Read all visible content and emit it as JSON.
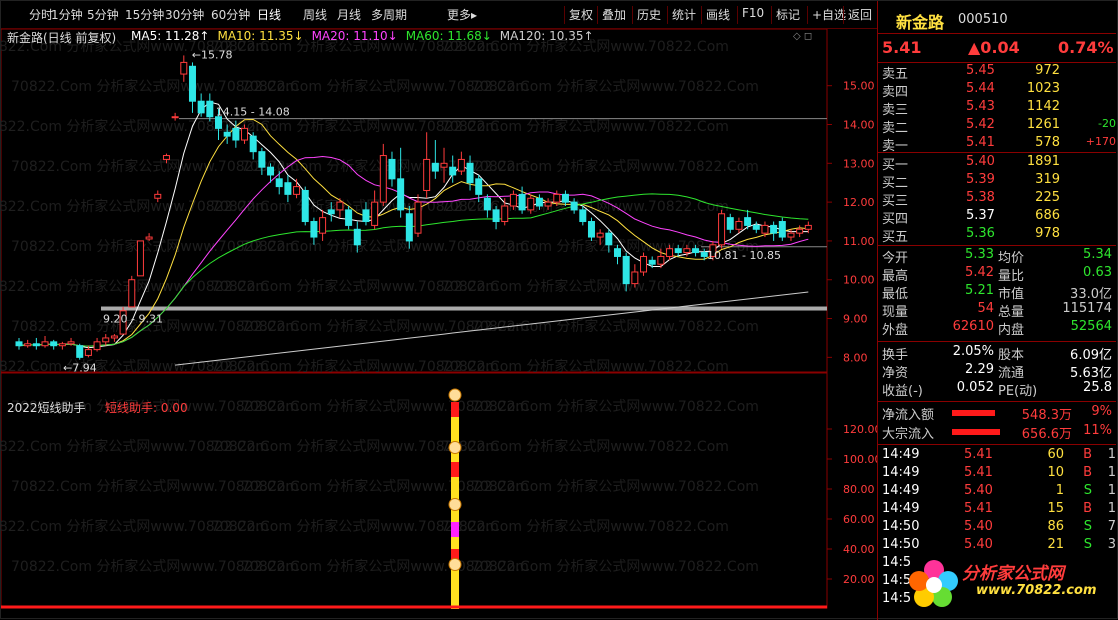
{
  "toolbar": {
    "left": [
      "分时",
      "1分钟",
      "5分钟",
      "15分钟",
      "30分钟",
      "60分钟",
      "日线",
      "周线",
      "月线",
      "多周期",
      "更多▸"
    ],
    "active": "日线",
    "right": [
      "复权",
      "叠加",
      "历史",
      "统计",
      "画线",
      "F10",
      "标记",
      "+自选",
      "返回"
    ]
  },
  "chart_header": {
    "title": "新金路(日线 前复权)",
    "ma": [
      {
        "label": "MA5: 11.28↑",
        "color": "#ffffff"
      },
      {
        "label": "MA10: 11.35↓",
        "color": "#ffe040"
      },
      {
        "label": "MA20: 11.10↓",
        "color": "#ff44ff"
      },
      {
        "label": "MA60: 11.68↓",
        "color": "#2ee62e"
      },
      {
        "label": "MA120: 10.35↑",
        "color": "#cccccc"
      }
    ]
  },
  "chart_data": [
    {
      "type": "line",
      "name": "main-kline",
      "y_ticks": [
        "15.00",
        "14.00",
        "13.00",
        "12.00",
        "11.00",
        "10.00",
        "9.00",
        "8.00"
      ],
      "ylim": [
        7.7,
        16.1
      ],
      "annotations": [
        "15.78",
        "14.15 - 14.08",
        "9.20 - 9.31",
        "10.81 - 10.85",
        "7.94"
      ],
      "candles": [
        {
          "o": 8.4,
          "c": 8.3,
          "h": 8.5,
          "l": 8.2
        },
        {
          "o": 8.3,
          "c": 8.35,
          "h": 8.45,
          "l": 8.25
        },
        {
          "o": 8.35,
          "c": 8.3,
          "h": 8.5,
          "l": 8.2
        },
        {
          "o": 8.3,
          "c": 8.4,
          "h": 8.55,
          "l": 8.25
        },
        {
          "o": 8.4,
          "c": 8.3,
          "h": 8.45,
          "l": 8.2
        },
        {
          "o": 8.3,
          "c": 8.35,
          "h": 8.4,
          "l": 8.2
        },
        {
          "o": 8.35,
          "c": 8.4,
          "h": 8.5,
          "l": 8.3
        },
        {
          "o": 8.3,
          "c": 8.0,
          "h": 8.35,
          "l": 7.94
        },
        {
          "o": 8.05,
          "c": 8.2,
          "h": 8.3,
          "l": 8.0
        },
        {
          "o": 8.2,
          "c": 8.4,
          "h": 8.5,
          "l": 8.15
        },
        {
          "o": 8.4,
          "c": 8.5,
          "h": 8.6,
          "l": 8.3
        },
        {
          "o": 8.5,
          "c": 8.55,
          "h": 8.6,
          "l": 8.4
        },
        {
          "o": 8.6,
          "c": 9.2,
          "h": 9.3,
          "l": 8.6
        },
        {
          "o": 9.3,
          "c": 10.0,
          "h": 10.1,
          "l": 9.3
        },
        {
          "o": 10.1,
          "c": 11.0,
          "h": 11.0,
          "l": 10.1
        },
        {
          "o": 11.05,
          "c": 11.1,
          "h": 11.2,
          "l": 11.0
        },
        {
          "o": 12.1,
          "c": 12.2,
          "h": 12.3,
          "l": 12.0
        },
        {
          "o": 13.1,
          "c": 13.2,
          "h": 13.25,
          "l": 13.0
        },
        {
          "o": 14.2,
          "c": 14.2,
          "h": 14.3,
          "l": 14.1
        },
        {
          "o": 15.3,
          "c": 15.6,
          "h": 15.78,
          "l": 15.1
        },
        {
          "o": 15.5,
          "c": 14.6,
          "h": 15.6,
          "l": 14.3
        },
        {
          "o": 14.6,
          "c": 14.3,
          "h": 14.8,
          "l": 14.2
        },
        {
          "o": 14.6,
          "c": 14.2,
          "h": 14.8,
          "l": 14.08
        },
        {
          "o": 14.2,
          "c": 13.9,
          "h": 14.4,
          "l": 13.6
        },
        {
          "o": 13.8,
          "c": 13.7,
          "h": 14.0,
          "l": 13.5
        },
        {
          "o": 13.9,
          "c": 13.6,
          "h": 14.1,
          "l": 13.4
        },
        {
          "o": 13.6,
          "c": 13.9,
          "h": 14.0,
          "l": 13.5
        },
        {
          "o": 13.7,
          "c": 13.3,
          "h": 13.8,
          "l": 13.1
        },
        {
          "o": 13.3,
          "c": 12.9,
          "h": 13.4,
          "l": 12.7
        },
        {
          "o": 12.9,
          "c": 12.7,
          "h": 13.0,
          "l": 12.5
        },
        {
          "o": 12.6,
          "c": 12.4,
          "h": 12.8,
          "l": 12.2
        },
        {
          "o": 12.5,
          "c": 12.2,
          "h": 12.7,
          "l": 12.0
        },
        {
          "o": 12.2,
          "c": 12.4,
          "h": 12.6,
          "l": 12.1
        },
        {
          "o": 12.3,
          "c": 11.5,
          "h": 12.4,
          "l": 11.4
        },
        {
          "o": 11.5,
          "c": 11.1,
          "h": 11.6,
          "l": 10.9
        },
        {
          "o": 11.2,
          "c": 11.6,
          "h": 11.8,
          "l": 11.0
        },
        {
          "o": 11.8,
          "c": 11.7,
          "h": 12.0,
          "l": 11.5
        },
        {
          "o": 11.8,
          "c": 12.0,
          "h": 12.1,
          "l": 11.6
        },
        {
          "o": 11.8,
          "c": 11.4,
          "h": 11.9,
          "l": 11.3
        },
        {
          "o": 11.3,
          "c": 10.9,
          "h": 11.5,
          "l": 10.7
        },
        {
          "o": 11.8,
          "c": 11.5,
          "h": 12.0,
          "l": 11.4
        },
        {
          "o": 11.4,
          "c": 12.0,
          "h": 12.3,
          "l": 11.3
        },
        {
          "o": 12.0,
          "c": 13.2,
          "h": 13.5,
          "l": 11.9
        },
        {
          "o": 13.1,
          "c": 12.6,
          "h": 13.3,
          "l": 12.4
        },
        {
          "o": 12.6,
          "c": 11.8,
          "h": 13.4,
          "l": 11.6
        },
        {
          "o": 11.7,
          "c": 11.0,
          "h": 11.9,
          "l": 10.8
        },
        {
          "o": 11.2,
          "c": 12.0,
          "h": 12.2,
          "l": 11.1
        },
        {
          "o": 12.3,
          "c": 13.1,
          "h": 13.8,
          "l": 12.1
        },
        {
          "o": 13.0,
          "c": 12.8,
          "h": 13.6,
          "l": 12.6
        },
        {
          "o": 12.9,
          "c": 13.0,
          "h": 13.4,
          "l": 12.5
        },
        {
          "o": 12.9,
          "c": 12.7,
          "h": 13.2,
          "l": 12.5
        },
        {
          "o": 12.8,
          "c": 13.1,
          "h": 13.3,
          "l": 12.7
        },
        {
          "o": 13.0,
          "c": 12.5,
          "h": 13.2,
          "l": 12.3
        },
        {
          "o": 12.6,
          "c": 12.2,
          "h": 12.7,
          "l": 12.0
        },
        {
          "o": 12.1,
          "c": 11.8,
          "h": 12.2,
          "l": 11.6
        },
        {
          "o": 11.8,
          "c": 11.5,
          "h": 11.9,
          "l": 11.3
        },
        {
          "o": 11.5,
          "c": 11.9,
          "h": 12.1,
          "l": 11.4
        },
        {
          "o": 11.9,
          "c": 12.2,
          "h": 12.3,
          "l": 11.8
        },
        {
          "o": 12.2,
          "c": 11.8,
          "h": 12.4,
          "l": 11.7
        },
        {
          "o": 11.8,
          "c": 12.1,
          "h": 12.2,
          "l": 11.7
        },
        {
          "o": 12.1,
          "c": 11.9,
          "h": 12.2,
          "l": 11.8
        },
        {
          "o": 11.9,
          "c": 12.0,
          "h": 12.1,
          "l": 11.8
        },
        {
          "o": 12.0,
          "c": 12.2,
          "h": 12.3,
          "l": 11.9
        },
        {
          "o": 12.2,
          "c": 12.0,
          "h": 12.3,
          "l": 11.9
        },
        {
          "o": 12.0,
          "c": 11.8,
          "h": 12.1,
          "l": 11.7
        },
        {
          "o": 11.8,
          "c": 11.5,
          "h": 11.9,
          "l": 11.4
        },
        {
          "o": 11.5,
          "c": 11.1,
          "h": 11.6,
          "l": 11.0
        },
        {
          "o": 11.1,
          "c": 11.2,
          "h": 11.3,
          "l": 10.9
        },
        {
          "o": 11.2,
          "c": 10.9,
          "h": 11.3,
          "l": 10.7
        },
        {
          "o": 10.8,
          "c": 10.6,
          "h": 10.9,
          "l": 10.4
        },
        {
          "o": 10.6,
          "c": 9.9,
          "h": 10.7,
          "l": 9.7
        },
        {
          "o": 9.9,
          "c": 10.2,
          "h": 10.4,
          "l": 9.8
        },
        {
          "o": 10.2,
          "c": 10.6,
          "h": 10.7,
          "l": 10.1
        },
        {
          "o": 10.5,
          "c": 10.4,
          "h": 10.6,
          "l": 10.3
        },
        {
          "o": 10.4,
          "c": 10.6,
          "h": 10.8,
          "l": 10.3
        },
        {
          "o": 10.6,
          "c": 10.8,
          "h": 10.9,
          "l": 10.5
        },
        {
          "o": 10.8,
          "c": 10.7,
          "h": 10.9,
          "l": 10.6
        },
        {
          "o": 10.7,
          "c": 10.8,
          "h": 10.9,
          "l": 10.6
        },
        {
          "o": 10.8,
          "c": 10.7,
          "h": 10.9,
          "l": 10.6
        },
        {
          "o": 10.7,
          "c": 10.6,
          "h": 10.8,
          "l": 10.5
        },
        {
          "o": 10.6,
          "c": 10.9,
          "h": 11.0,
          "l": 10.5
        },
        {
          "o": 10.9,
          "c": 11.7,
          "h": 11.8,
          "l": 10.8
        },
        {
          "o": 11.6,
          "c": 11.3,
          "h": 11.7,
          "l": 11.2
        },
        {
          "o": 11.3,
          "c": 11.5,
          "h": 11.6,
          "l": 11.2
        },
        {
          "o": 11.6,
          "c": 11.4,
          "h": 11.8,
          "l": 11.3
        },
        {
          "o": 11.4,
          "c": 11.3,
          "h": 11.5,
          "l": 11.2
        },
        {
          "o": 11.2,
          "c": 11.4,
          "h": 11.5,
          "l": 11.1
        },
        {
          "o": 11.4,
          "c": 11.2,
          "h": 11.5,
          "l": 11.0
        },
        {
          "o": 11.5,
          "c": 11.1,
          "h": 11.6,
          "l": 11.0
        },
        {
          "o": 11.1,
          "c": 11.2,
          "h": 11.3,
          "l": 11.0
        },
        {
          "o": 11.2,
          "c": 11.3,
          "h": 11.4,
          "l": 11.1
        },
        {
          "o": 11.3,
          "c": 11.4,
          "h": 11.5,
          "l": 11.2
        }
      ]
    },
    {
      "type": "bar",
      "name": "indicator-短线助手",
      "y_ticks": [
        "120.00",
        "100.00",
        "80.00",
        "60.00",
        "40.00",
        "20.00"
      ],
      "ylim": [
        0,
        140
      ],
      "title": "2022短线助手",
      "indicator_label": "短线助手: 0.00"
    }
  ],
  "watermark": "70822.Com 分析家公式网www.70822.Com",
  "quote": {
    "name": "新金路",
    "code": "000510",
    "price": "5.41",
    "change": "▲0.04",
    "pct": "0.74%",
    "asks": [
      {
        "label": "卖五",
        "price": "5.45",
        "vol": "972",
        "chg": ""
      },
      {
        "label": "卖四",
        "price": "5.44",
        "vol": "1023",
        "chg": ""
      },
      {
        "label": "卖三",
        "price": "5.43",
        "vol": "1142",
        "chg": ""
      },
      {
        "label": "卖二",
        "price": "5.42",
        "vol": "1261",
        "chg": "-20"
      },
      {
        "label": "卖一",
        "price": "5.41",
        "vol": "578",
        "chg": "+170"
      }
    ],
    "bids": [
      {
        "label": "买一",
        "price": "5.40",
        "vol": "1891",
        "pc": "red"
      },
      {
        "label": "买二",
        "price": "5.39",
        "vol": "319",
        "pc": "red"
      },
      {
        "label": "买三",
        "price": "5.38",
        "vol": "225",
        "pc": "red"
      },
      {
        "label": "买四",
        "price": "5.37",
        "vol": "686",
        "pc": "wht"
      },
      {
        "label": "买五",
        "price": "5.36",
        "vol": "978",
        "pc": "grn"
      }
    ],
    "stats": [
      {
        "l1": "今开",
        "v1": "5.33",
        "c1": "grn",
        "l2": "均价",
        "v2": "5.34",
        "c2": "grn"
      },
      {
        "l1": "最高",
        "v1": "5.42",
        "c1": "red",
        "l2": "量比",
        "v2": "0.63",
        "c2": "grn"
      },
      {
        "l1": "最低",
        "v1": "5.21",
        "c1": "grn",
        "l2": "市值",
        "v2": "33.0亿",
        "c2": "gry"
      },
      {
        "l1": "现量",
        "v1": "54",
        "c1": "red",
        "l2": "总量",
        "v2": "115174",
        "c2": "gry"
      },
      {
        "l1": "外盘",
        "v1": "62610",
        "c1": "red",
        "l2": "内盘",
        "v2": "52564",
        "c2": "grn"
      }
    ],
    "stats2": [
      {
        "l1": "换手",
        "v1": "2.05%",
        "l2": "股本",
        "v2": "6.09亿"
      },
      {
        "l1": "净资",
        "v1": "2.29",
        "l2": "流通",
        "v2": "5.63亿"
      },
      {
        "l1": "收益(-)",
        "v1": "0.052",
        "l2": "PE(动)",
        "v2": "25.8"
      }
    ],
    "flows": [
      {
        "label": "净流入额",
        "value": "548.3万",
        "pct": "9%",
        "fill": 0.9
      },
      {
        "label": "大宗流入",
        "value": "656.6万",
        "pct": "11%",
        "fill": 1.0
      }
    ],
    "ticks": [
      {
        "t": "14:49",
        "p": "5.41",
        "v": "60",
        "d": "B",
        "n": "1"
      },
      {
        "t": "14:49",
        "p": "5.41",
        "v": "10",
        "d": "B",
        "n": "1"
      },
      {
        "t": "14:49",
        "p": "5.40",
        "v": "1",
        "d": "S",
        "n": "1"
      },
      {
        "t": "14:49",
        "p": "5.41",
        "v": "15",
        "d": "B",
        "n": "1"
      },
      {
        "t": "14:50",
        "p": "5.40",
        "v": "86",
        "d": "S",
        "n": "7"
      },
      {
        "t": "14:50",
        "p": "5.40",
        "v": "21",
        "d": "S",
        "n": "3"
      },
      {
        "t": "14:5",
        "p": "",
        "v": "",
        "d": "",
        "n": ""
      },
      {
        "t": "14:5",
        "p": "",
        "v": "",
        "d": "",
        "n": ""
      },
      {
        "t": "14:5",
        "p": "",
        "v": "",
        "d": "",
        "n": ""
      }
    ],
    "logo_text": "分析家公式网",
    "logo_url": "www.70822.com"
  }
}
